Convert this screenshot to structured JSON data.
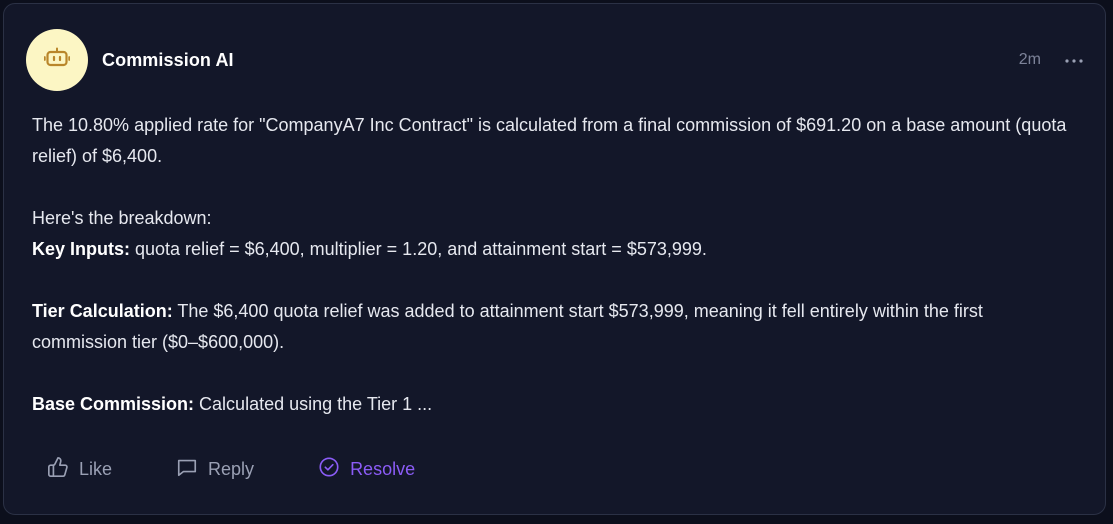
{
  "comment": {
    "author": "Commission AI",
    "timestamp": "2m",
    "avatar_icon": "robot-icon",
    "avatar_bg": "#fcf6c4",
    "paragraph1": "The 10.80% applied rate for \"CompanyA7 Inc Contract\" is calculated from a final commission of $691.20 on a base amount (quota relief) of $6,400.",
    "breakdown_intro": "Here's the breakdown:",
    "key_inputs_label": "Key Inputs:",
    "key_inputs_text": " quota relief = $6,400, multiplier = 1.20, and attainment start = $573,999.",
    "tier_label": "Tier Calculation:",
    "tier_text": " The $6,400 quota relief was added to attainment start $573,999, meaning it fell entirely within the first commission tier ($0–$600,000).",
    "base_label": "Base Commission:",
    "base_text": " Calculated using the Tier 1 ..."
  },
  "actions": {
    "like_label": "Like",
    "reply_label": "Reply",
    "resolve_label": "Resolve",
    "resolve_color": "#8b5cf6"
  }
}
